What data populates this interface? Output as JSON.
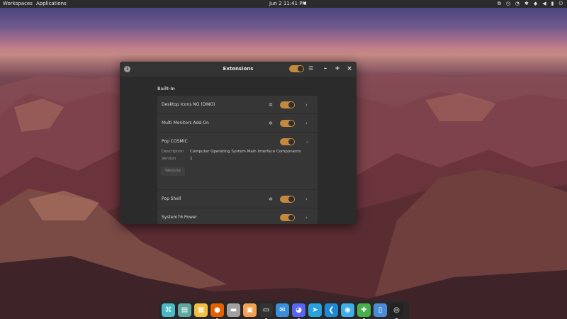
{
  "topbar": {
    "workspaces": "Workspaces",
    "applications": "Applications",
    "clock": "Jun 2  11:41 PM",
    "tray_icons": [
      "media-icon",
      "timer-icon",
      "notifications-icon",
      "bluetooth-icon",
      "network-icon",
      "volume-icon",
      "battery-icon",
      "power-icon"
    ]
  },
  "window": {
    "title": "Extensions",
    "global_toggle": true,
    "section_title": "Built-In",
    "extensions": [
      {
        "name": "Desktop Icons NG (DING)",
        "enabled": true,
        "has_settings": true,
        "expanded": false
      },
      {
        "name": "Multi Monitors Add-On",
        "enabled": true,
        "has_settings": true,
        "expanded": false
      },
      {
        "name": "Pop COSMIC",
        "enabled": true,
        "has_settings": false,
        "expanded": true
      },
      {
        "name": "Pop Shell",
        "enabled": true,
        "has_settings": true,
        "expanded": false
      },
      {
        "name": "System76 Power",
        "enabled": true,
        "has_settings": false,
        "expanded": false
      }
    ],
    "details": {
      "description_key": "Description",
      "description_val": "Computer Operating System Main Interface Components",
      "version_key": "Version",
      "version_val": "1",
      "website_button": "Website"
    }
  },
  "dock": {
    "apps": [
      {
        "name": "cosmic-launcher",
        "icon": "apps-launcher-icon",
        "color": "#48b9c7",
        "running": false
      },
      {
        "name": "workspaces",
        "icon": "workspaces-icon",
        "color": "#5fa8a0",
        "running": false
      },
      {
        "name": "applications",
        "icon": "app-grid-icon",
        "color": "#f0c040",
        "running": false
      },
      {
        "name": "firefox",
        "icon": "firefox-icon",
        "color": "#e66000",
        "running": true
      },
      {
        "name": "files",
        "icon": "files-icon",
        "color": "#a0a0a0",
        "running": false
      },
      {
        "name": "pop-shop",
        "icon": "shop-icon",
        "color": "#f2a154",
        "running": false
      },
      {
        "name": "terminal",
        "icon": "terminal-icon",
        "color": "#333333",
        "running": true
      },
      {
        "name": "mailspring",
        "icon": "mail-icon",
        "color": "#3a8fd8",
        "running": false
      },
      {
        "name": "discord",
        "icon": "discord-icon",
        "color": "#5865f2",
        "running": true
      },
      {
        "name": "telegram",
        "icon": "telegram-icon",
        "color": "#2aa1da",
        "running": false
      },
      {
        "name": "vscode",
        "icon": "vscode-icon",
        "color": "#1f8ad2",
        "running": false
      },
      {
        "name": "timeshift",
        "icon": "timeshift-icon",
        "color": "#3daee9",
        "running": false
      },
      {
        "name": "extensions",
        "icon": "puzzle-icon",
        "color": "#47b04b",
        "running": true
      },
      {
        "name": "text-editor",
        "icon": "document-icon",
        "color": "#4a8cd8",
        "running": false
      },
      {
        "name": "obs",
        "icon": "obs-icon",
        "color": "#222222",
        "running": true
      }
    ]
  },
  "colors": {
    "accent": "#c4893c",
    "window_bg": "#2b2b2b",
    "list_bg": "#363636"
  }
}
